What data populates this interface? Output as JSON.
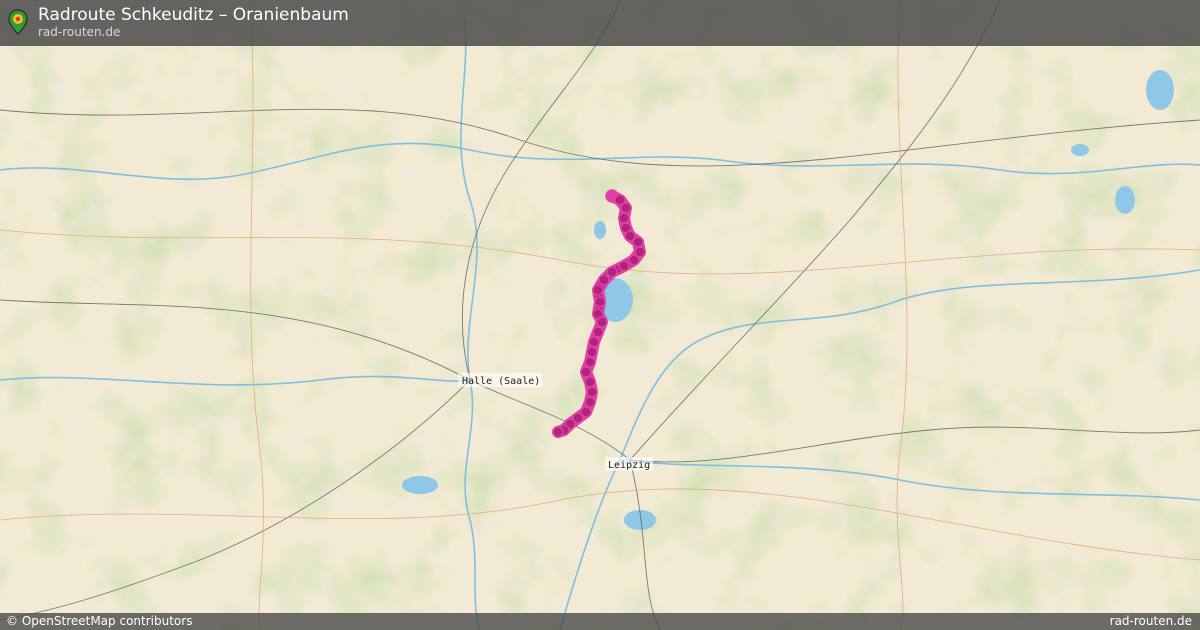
{
  "header": {
    "title": "Radroute Schkeuditz – Oranienbaum",
    "subtitle": "rad-routen.de",
    "logo_icon": "map-pin-icon"
  },
  "map": {
    "cities": [
      {
        "name": "Halle (Saale)"
      },
      {
        "name": "Leipzig"
      }
    ],
    "route_color": "#b0247a",
    "route_outline_color": "#e040a8",
    "forest_color": "#a6c277",
    "water_color": "#8fc7e6",
    "base_color": "#f2ead3"
  },
  "footer": {
    "attribution": "© OpenStreetMap contributors",
    "brand": "rad-routen.de"
  }
}
